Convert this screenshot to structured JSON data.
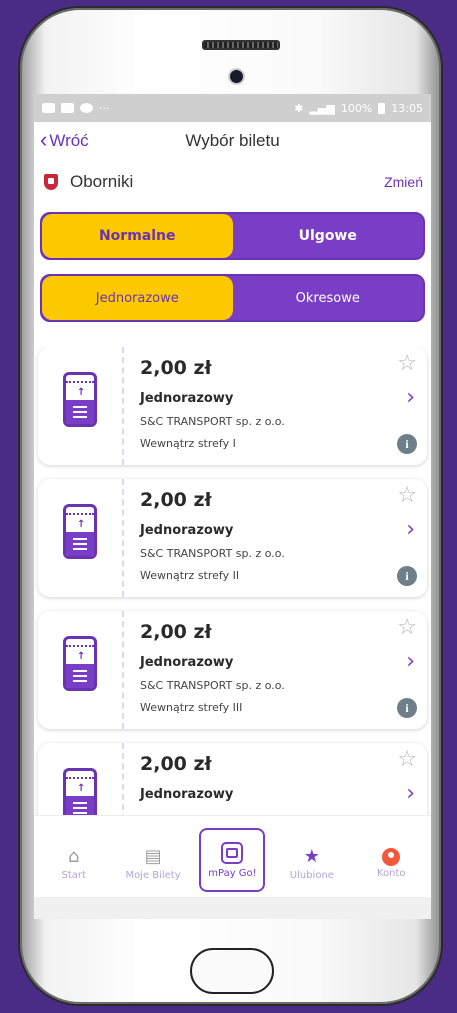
{
  "status_bar": {
    "battery": "100%",
    "time": "13:05"
  },
  "header": {
    "back_label": "Wróć",
    "title": "Wybór biletu"
  },
  "city": {
    "name": "Oborniki",
    "change_label": "Zmień"
  },
  "fare_toggle": {
    "options": [
      "Normalne",
      "Ulgowe"
    ],
    "selected": "Normalne"
  },
  "period_toggle": {
    "options": [
      "Jednorazowe",
      "Okresowe"
    ],
    "selected": "Jednorazowe"
  },
  "tickets": [
    {
      "price": "2,00 zł",
      "kind": "Jednorazowy",
      "carrier": "S&C TRANSPORT sp. z o.o.",
      "zone": "Wewnątrz strefy I"
    },
    {
      "price": "2,00 zł",
      "kind": "Jednorazowy",
      "carrier": "S&C TRANSPORT sp. z o.o.",
      "zone": "Wewnątrz strefy II"
    },
    {
      "price": "2,00 zł",
      "kind": "Jednorazowy",
      "carrier": "S&C TRANSPORT sp. z o.o.",
      "zone": "Wewnątrz strefy III"
    },
    {
      "price": "2,00 zł",
      "kind": "Jednorazowy",
      "carrier": "",
      "zone": ""
    }
  ],
  "bottom_nav": {
    "items": [
      {
        "label": "Start",
        "icon": "home-icon"
      },
      {
        "label": "Moje Bilety",
        "icon": "tickets-icon"
      },
      {
        "label": "mPay Go!",
        "icon": "bus-icon"
      },
      {
        "label": "Ulubione",
        "icon": "star-icon"
      },
      {
        "label": "Konto",
        "icon": "account-icon"
      }
    ]
  },
  "colors": {
    "accent": "#7a3ec6",
    "highlight": "#fcc800",
    "background": "#4a2c86"
  }
}
